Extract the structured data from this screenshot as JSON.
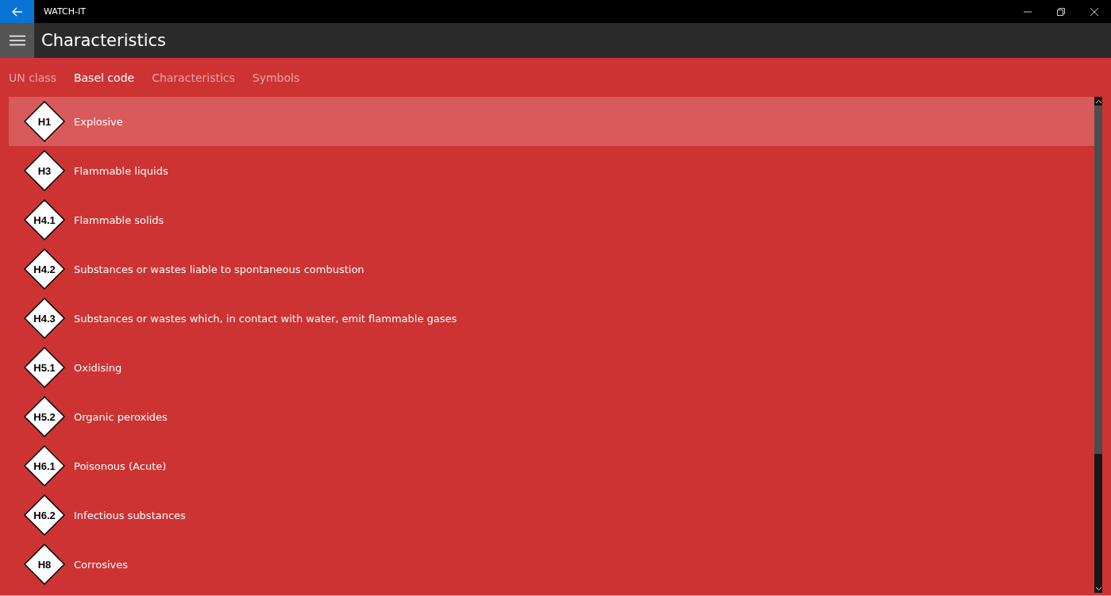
{
  "window": {
    "title": "WATCH-IT"
  },
  "header": {
    "title": "Characteristics"
  },
  "tabs": [
    {
      "label": "UN class",
      "selected": false
    },
    {
      "label": "Basel code",
      "selected": true
    },
    {
      "label": "Characteristics",
      "selected": false
    },
    {
      "label": "Symbols",
      "selected": false
    }
  ],
  "items": [
    {
      "code": "H1",
      "name": "Explosive",
      "selected": true
    },
    {
      "code": "H3",
      "name": "Flammable liquids",
      "selected": false
    },
    {
      "code": "H4.1",
      "name": "Flammable solids",
      "selected": false
    },
    {
      "code": "H4.2",
      "name": "Substances or wastes liable to spontaneous combustion",
      "selected": false
    },
    {
      "code": "H4.3",
      "name": "Substances or wastes which, in contact with water, emit flammable gases",
      "selected": false
    },
    {
      "code": "H5.1",
      "name": "Oxidising",
      "selected": false
    },
    {
      "code": "H5.2",
      "name": "Organic peroxides",
      "selected": false
    },
    {
      "code": "H6.1",
      "name": "Poisonous (Acute)",
      "selected": false
    },
    {
      "code": "H6.2",
      "name": "Infectious substances",
      "selected": false
    },
    {
      "code": "H8",
      "name": "Corrosives",
      "selected": false
    }
  ]
}
